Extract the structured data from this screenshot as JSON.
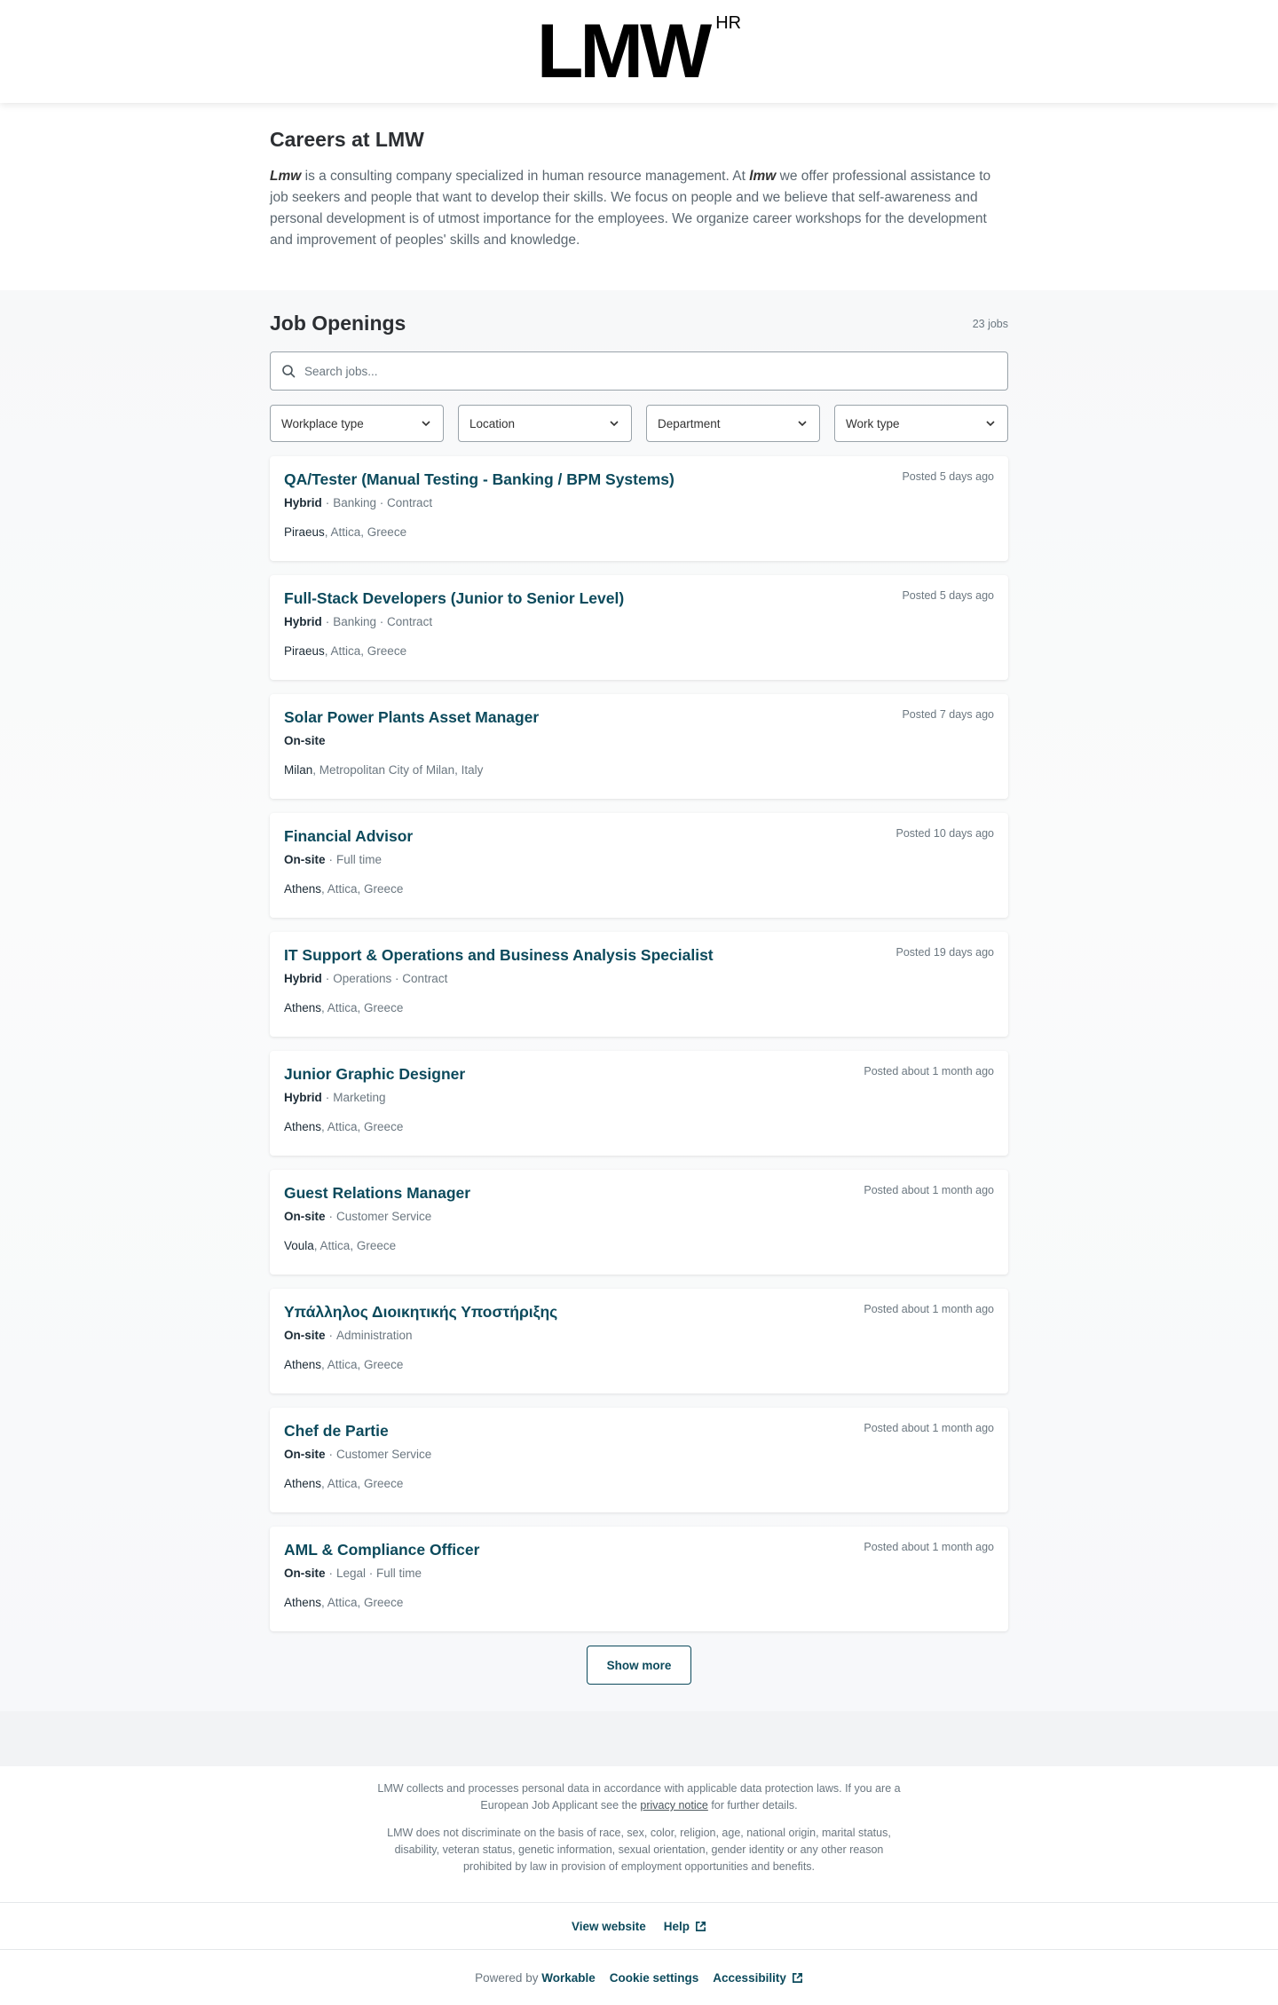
{
  "header": {
    "logo_text": "LMW",
    "logo_sup": "HR"
  },
  "about": {
    "title": "Careers at LMW",
    "brand1": "Lmw",
    "text1": " is a consulting company specialized in human resource management. At ",
    "brand2": "lmw",
    "text2": " we offer professional assistance to job seekers and people that want to develop their skills. We focus on people and we believe that self-awareness and personal development is of utmost importance for the employees. We organize career workshops for the development and improvement of peoples' skills and knowledge."
  },
  "jobs": {
    "title": "Job Openings",
    "count": "23 jobs",
    "search_placeholder": "Search jobs...",
    "filters": [
      "Workplace type",
      "Location",
      "Department",
      "Work type"
    ],
    "show_more": "Show more",
    "items": [
      {
        "title": "QA/Tester (Manual Testing - Banking / BPM Systems)",
        "posted": "Posted 5 days ago",
        "workplace": "Hybrid",
        "tags": "Banking · Contract",
        "city": "Piraeus",
        "region": ", Attica, Greece"
      },
      {
        "title": "Full-Stack Developers (Junior to Senior Level)",
        "posted": "Posted 5 days ago",
        "workplace": "Hybrid",
        "tags": "Banking · Contract",
        "city": "Piraeus",
        "region": ", Attica, Greece"
      },
      {
        "title": "Solar Power Plants Asset Manager",
        "posted": "Posted 7 days ago",
        "workplace": "On-site",
        "tags": "",
        "city": "Milan",
        "region": ", Metropolitan City of Milan, Italy"
      },
      {
        "title": "Financial Advisor",
        "posted": "Posted 10 days ago",
        "workplace": "On-site",
        "tags": "Full time",
        "city": "Athens",
        "region": ", Attica, Greece"
      },
      {
        "title": "IT Support & Operations and Business Analysis Specialist",
        "posted": "Posted 19 days ago",
        "workplace": "Hybrid",
        "tags": "Operations · Contract",
        "city": "Athens",
        "region": ", Attica, Greece"
      },
      {
        "title": "Junior Graphic Designer",
        "posted": "Posted about 1 month ago",
        "workplace": "Hybrid",
        "tags": "Marketing",
        "city": "Athens",
        "region": ", Attica, Greece"
      },
      {
        "title": "Guest Relations Manager",
        "posted": "Posted about 1 month ago",
        "workplace": "On-site",
        "tags": "Customer Service",
        "city": "Voula",
        "region": ", Attica, Greece"
      },
      {
        "title": "Υπάλληλος Διοικητικής Υποστήριξης",
        "posted": "Posted about 1 month ago",
        "workplace": "On-site",
        "tags": "Administration",
        "city": "Athens",
        "region": ", Attica, Greece"
      },
      {
        "title": "Chef de Partie",
        "posted": "Posted about 1 month ago",
        "workplace": "On-site",
        "tags": "Customer Service",
        "city": "Athens",
        "region": ", Attica, Greece"
      },
      {
        "title": "AML & Compliance Officer",
        "posted": "Posted about 1 month ago",
        "workplace": "On-site",
        "tags": "Legal · Full time",
        "city": "Athens",
        "region": ", Attica, Greece"
      }
    ]
  },
  "footer": {
    "legal1_a": "LMW collects and processes personal data in accordance with applicable data protection laws. If you are a European Job Applicant see the ",
    "privacy_link": "privacy notice",
    "legal1_b": " for further details.",
    "legal2": "LMW does not discriminate on the basis of race, sex, color, religion, age, national origin, marital status, disability, veteran status, genetic information, sexual orientation, gender identity or any other reason prohibited by law in provision of employment opportunities and benefits.",
    "view_website": "View website",
    "help": "Help",
    "powered_by": "Powered by",
    "workable": "Workable",
    "cookie_settings": "Cookie settings",
    "accessibility": "Accessibility"
  },
  "colors": {
    "accent": "#0c4a5c",
    "muted_text": "#6b7780"
  }
}
